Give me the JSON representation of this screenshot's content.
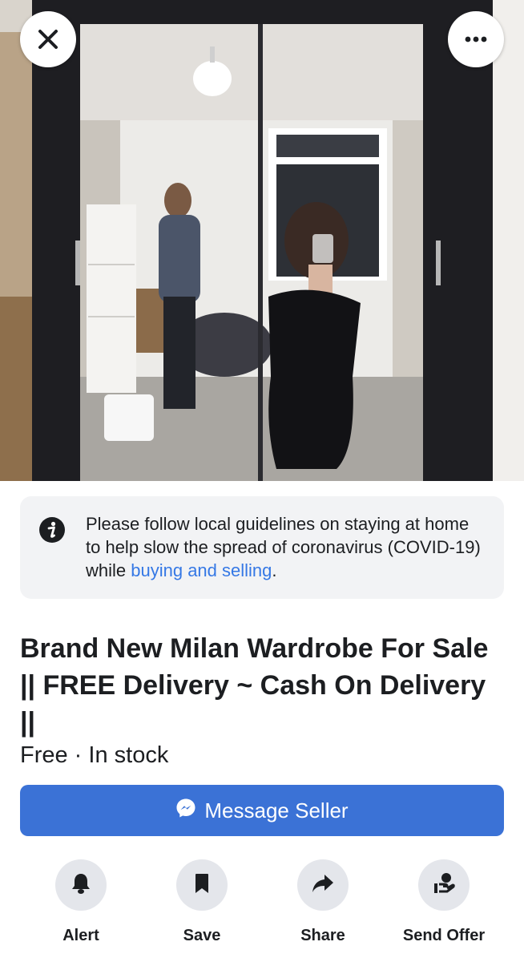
{
  "listing_photo": {
    "alt": "Photo of a mirrored wardrobe"
  },
  "header": {
    "close_icon": "close-icon",
    "more_icon": "more-horizontal-icon"
  },
  "notice": {
    "icon": "info-icon",
    "text": "Please follow local guidelines on staying at home to help slow the spread of coronavirus (COVID-19) while ",
    "link_text": "buying and selling",
    "trailing": "."
  },
  "listing": {
    "title": "Brand New Milan Wardrobe For Sale || FREE Delivery ~ Cash On Delivery ||",
    "price_line": "Free · In stock"
  },
  "message_button": {
    "icon": "messenger-icon",
    "label": "Message Seller"
  },
  "actions": [
    {
      "label": "Alert",
      "icon": "bell-icon"
    },
    {
      "label": "Save",
      "icon": "bookmark-icon"
    },
    {
      "label": "Share",
      "icon": "share-arrow-icon"
    },
    {
      "label": "Send Offer",
      "icon": "offer-hand-icon"
    }
  ],
  "colors": {
    "accent": "#3b72d6",
    "link": "#3578e5",
    "notice_bg": "#f2f3f5",
    "action_circle": "#e4e6eb"
  }
}
